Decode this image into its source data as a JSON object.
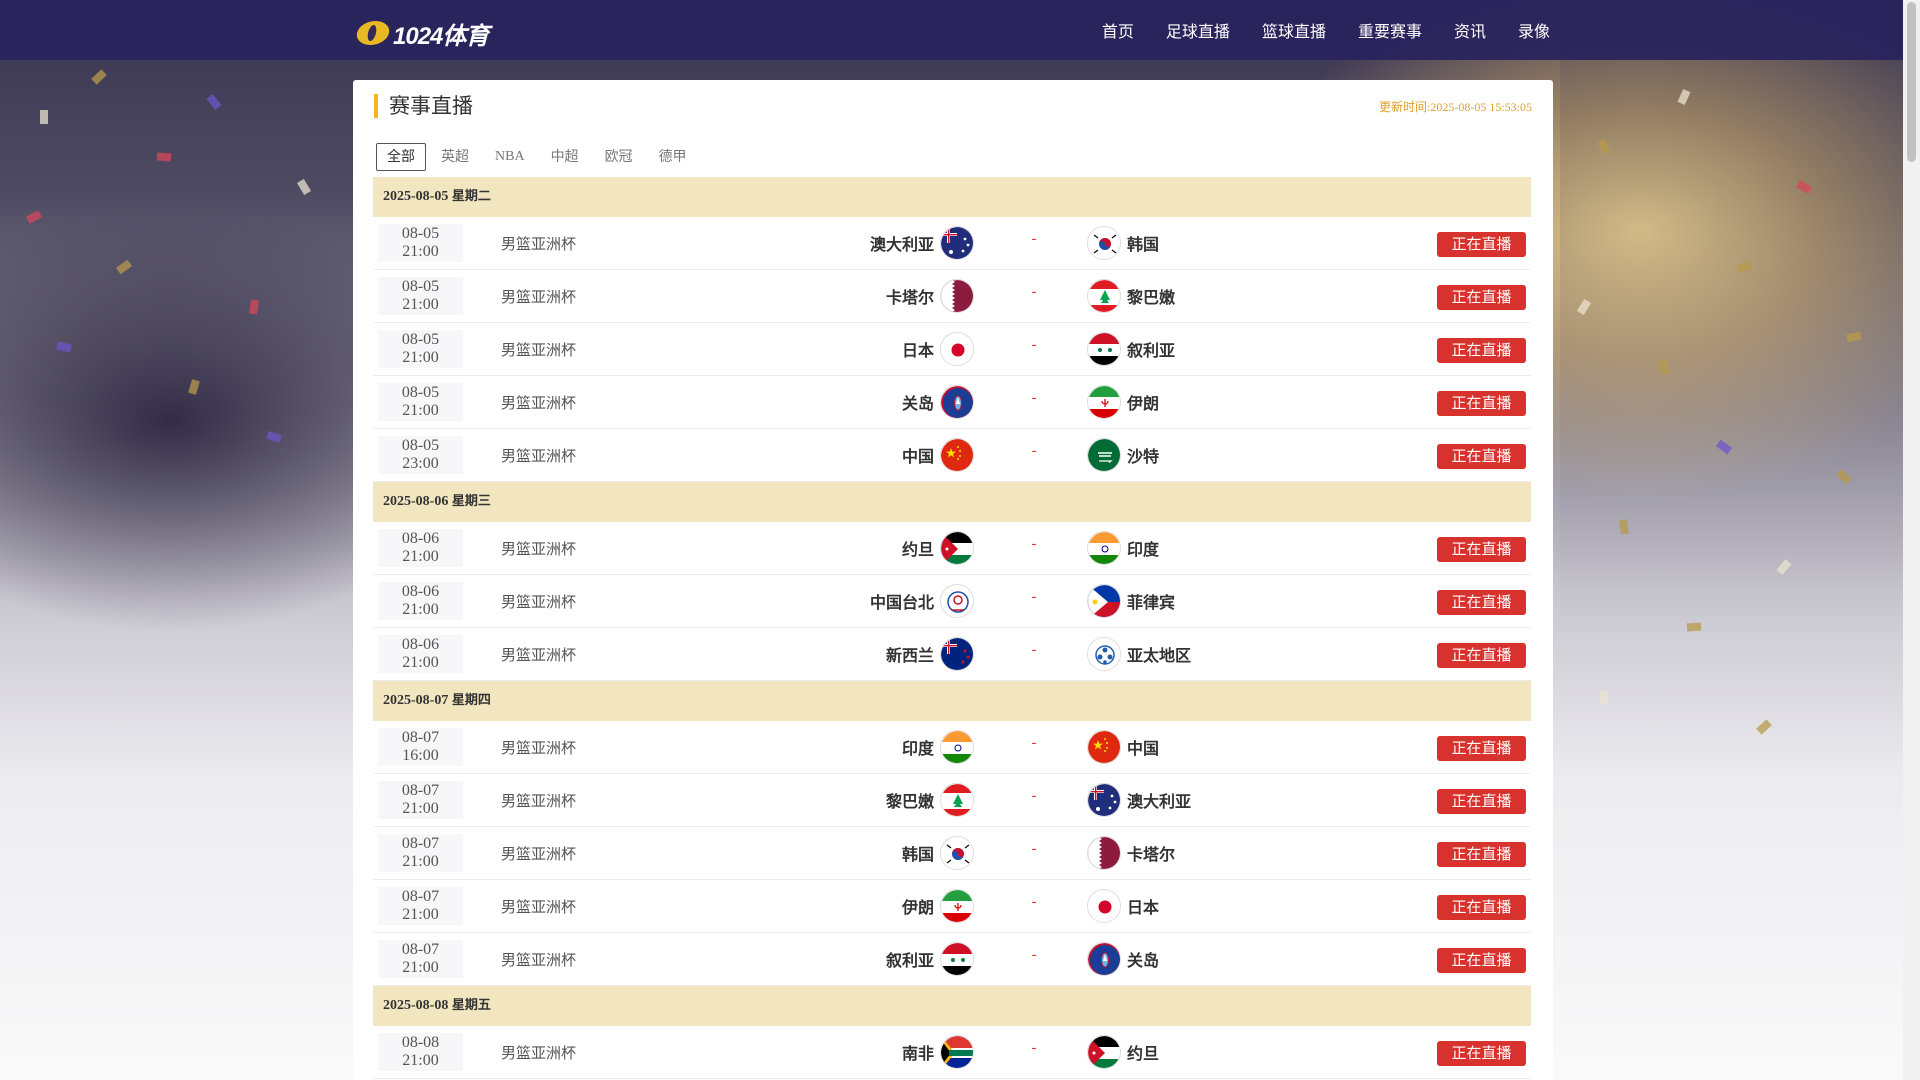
{
  "brand": {
    "logo_text": "1024体育",
    "accent": "#f5b51c",
    "nav_bg": "#28225c"
  },
  "nav": [
    {
      "label": "首页"
    },
    {
      "label": "足球直播"
    },
    {
      "label": "篮球直播"
    },
    {
      "label": "重要赛事"
    },
    {
      "label": "资讯"
    },
    {
      "label": "录像"
    }
  ],
  "panel": {
    "title": "赛事直播",
    "update_label": "更新时间:",
    "update_time": "2025-08-05 15:53:05"
  },
  "filters": [
    {
      "label": "全部",
      "active": true
    },
    {
      "label": "英超",
      "active": false
    },
    {
      "label": "NBA",
      "active": false
    },
    {
      "label": "中超",
      "active": false
    },
    {
      "label": "欧冠",
      "active": false
    },
    {
      "label": "德甲",
      "active": false
    }
  ],
  "live_label": "正在直播",
  "vs_label": "-",
  "days": [
    {
      "date": "2025-08-05",
      "weekday": "星期二",
      "matches": [
        {
          "date": "08-05",
          "time": "21:00",
          "league": "男篮亚洲杯",
          "home": "澳大利亚",
          "home_flag": "australia",
          "away": "韩国",
          "away_flag": "korea"
        },
        {
          "date": "08-05",
          "time": "21:00",
          "league": "男篮亚洲杯",
          "home": "卡塔尔",
          "home_flag": "qatar",
          "away": "黎巴嫩",
          "away_flag": "lebanon"
        },
        {
          "date": "08-05",
          "time": "21:00",
          "league": "男篮亚洲杯",
          "home": "日本",
          "home_flag": "japan",
          "away": "叙利亚",
          "away_flag": "syria"
        },
        {
          "date": "08-05",
          "time": "21:00",
          "league": "男篮亚洲杯",
          "home": "关岛",
          "home_flag": "guam",
          "away": "伊朗",
          "away_flag": "iran"
        },
        {
          "date": "08-05",
          "time": "23:00",
          "league": "男篮亚洲杯",
          "home": "中国",
          "home_flag": "china",
          "away": "沙特",
          "away_flag": "saudi"
        }
      ]
    },
    {
      "date": "2025-08-06",
      "weekday": "星期三",
      "matches": [
        {
          "date": "08-06",
          "time": "21:00",
          "league": "男篮亚洲杯",
          "home": "约旦",
          "home_flag": "jordan",
          "away": "印度",
          "away_flag": "india"
        },
        {
          "date": "08-06",
          "time": "21:00",
          "league": "男篮亚洲杯",
          "home": "中国台北",
          "home_flag": "chinese-taipei",
          "away": "菲律宾",
          "away_flag": "philippines"
        },
        {
          "date": "08-06",
          "time": "21:00",
          "league": "男篮亚洲杯",
          "home": "新西兰",
          "home_flag": "newzealand",
          "away": "亚太地区",
          "away_flag": "asia-pacific"
        }
      ]
    },
    {
      "date": "2025-08-07",
      "weekday": "星期四",
      "matches": [
        {
          "date": "08-07",
          "time": "16:00",
          "league": "男篮亚洲杯",
          "home": "印度",
          "home_flag": "india",
          "away": "中国",
          "away_flag": "china"
        },
        {
          "date": "08-07",
          "time": "21:00",
          "league": "男篮亚洲杯",
          "home": "黎巴嫩",
          "home_flag": "lebanon",
          "away": "澳大利亚",
          "away_flag": "australia"
        },
        {
          "date": "08-07",
          "time": "21:00",
          "league": "男篮亚洲杯",
          "home": "韩国",
          "home_flag": "korea",
          "away": "卡塔尔",
          "away_flag": "qatar"
        },
        {
          "date": "08-07",
          "time": "21:00",
          "league": "男篮亚洲杯",
          "home": "伊朗",
          "home_flag": "iran",
          "away": "日本",
          "away_flag": "japan"
        },
        {
          "date": "08-07",
          "time": "21:00",
          "league": "男篮亚洲杯",
          "home": "叙利亚",
          "home_flag": "syria",
          "away": "关岛",
          "away_flag": "guam"
        }
      ]
    },
    {
      "date": "2025-08-08",
      "weekday": "星期五",
      "matches": [
        {
          "date": "08-08",
          "time": "21:00",
          "league": "男篮亚洲杯",
          "home": "南非",
          "home_flag": "southafrica",
          "away": "约旦",
          "away_flag": "jordan"
        }
      ]
    }
  ]
}
